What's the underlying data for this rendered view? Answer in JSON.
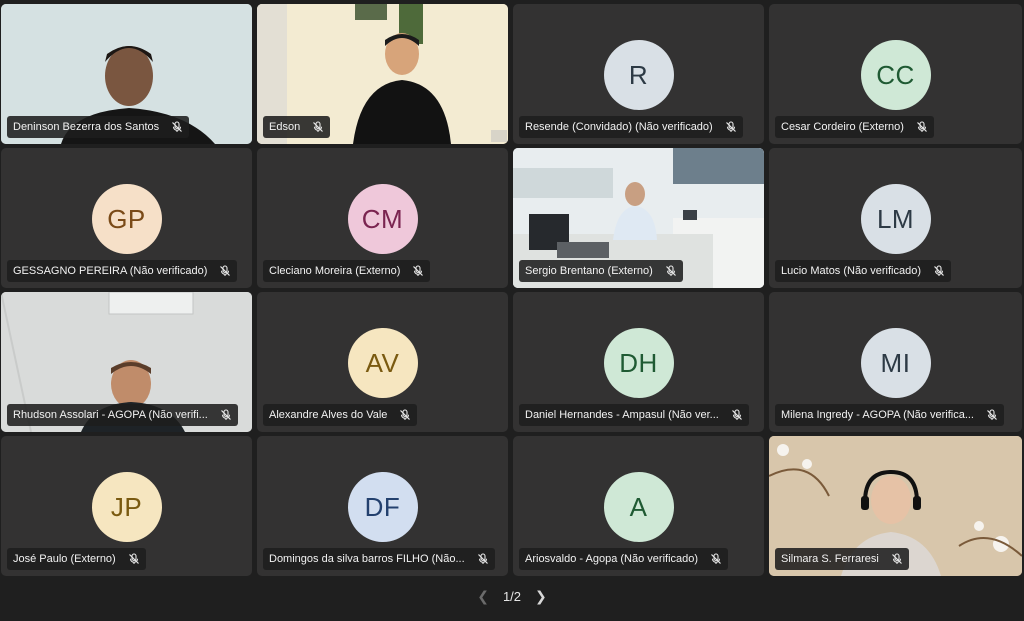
{
  "participants": [
    {
      "name": "Deninson Bezerra dos Santos",
      "type": "video",
      "scene": "scene-1"
    },
    {
      "name": "Edson",
      "type": "video",
      "scene": "scene-2"
    },
    {
      "name": "Resende (Convidado) (Não verificado)",
      "type": "avatar",
      "initials": "R",
      "color": "#d9e0e6",
      "text_color": "#2d3a45"
    },
    {
      "name": "Cesar Cordeiro (Externo)",
      "type": "avatar",
      "initials": "CC",
      "color": "#cfe8d6",
      "text_color": "#1f5a33"
    },
    {
      "name": "GESSAGNO PEREIRA (Não verificado)",
      "type": "avatar",
      "initials": "GP",
      "color": "#f6e0c8",
      "text_color": "#7a4a17"
    },
    {
      "name": "Cleciano Moreira (Externo)",
      "type": "avatar",
      "initials": "CM",
      "color": "#efc8da",
      "text_color": "#7a2450"
    },
    {
      "name": "Sergio Brentano (Externo)",
      "type": "video",
      "scene": "scene-3"
    },
    {
      "name": "Lucio Matos (Não verificado)",
      "type": "avatar",
      "initials": "LM",
      "color": "#d9e0e6",
      "text_color": "#2d3a45"
    },
    {
      "name": "Rhudson Assolari - AGOPA (Não verifi...",
      "type": "video",
      "scene": "scene-4"
    },
    {
      "name": "Alexandre Alves do Vale",
      "type": "avatar",
      "initials": "AV",
      "color": "#f6e6c0",
      "text_color": "#7a5a10"
    },
    {
      "name": "Daniel Hernandes - Ampasul (Não ver...",
      "type": "avatar",
      "initials": "DH",
      "color": "#cfe8d6",
      "text_color": "#1f5a33"
    },
    {
      "name": "Milena Ingredy - AGOPA (Não verifica...",
      "type": "avatar",
      "initials": "MI",
      "color": "#d9e0e6",
      "text_color": "#2d3a45"
    },
    {
      "name": "José Paulo (Externo)",
      "type": "avatar",
      "initials": "JP",
      "color": "#f6e6c0",
      "text_color": "#7a5a10"
    },
    {
      "name": "Domingos da silva barros FILHO (Não...",
      "type": "avatar",
      "initials": "DF",
      "color": "#d2def0",
      "text_color": "#23406e"
    },
    {
      "name": "Ariosvaldo - Agopa (Não verificado)",
      "type": "avatar",
      "initials": "A",
      "color": "#cfe8d6",
      "text_color": "#1f5a33"
    },
    {
      "name": "Silmara S. Ferraresi",
      "type": "video",
      "scene": "scene-5"
    }
  ],
  "pager": {
    "label": "1/2",
    "prev_icon": "chevron-left-icon",
    "next_icon": "chevron-right-icon"
  },
  "icons": {
    "mute": "mic-off-icon"
  }
}
